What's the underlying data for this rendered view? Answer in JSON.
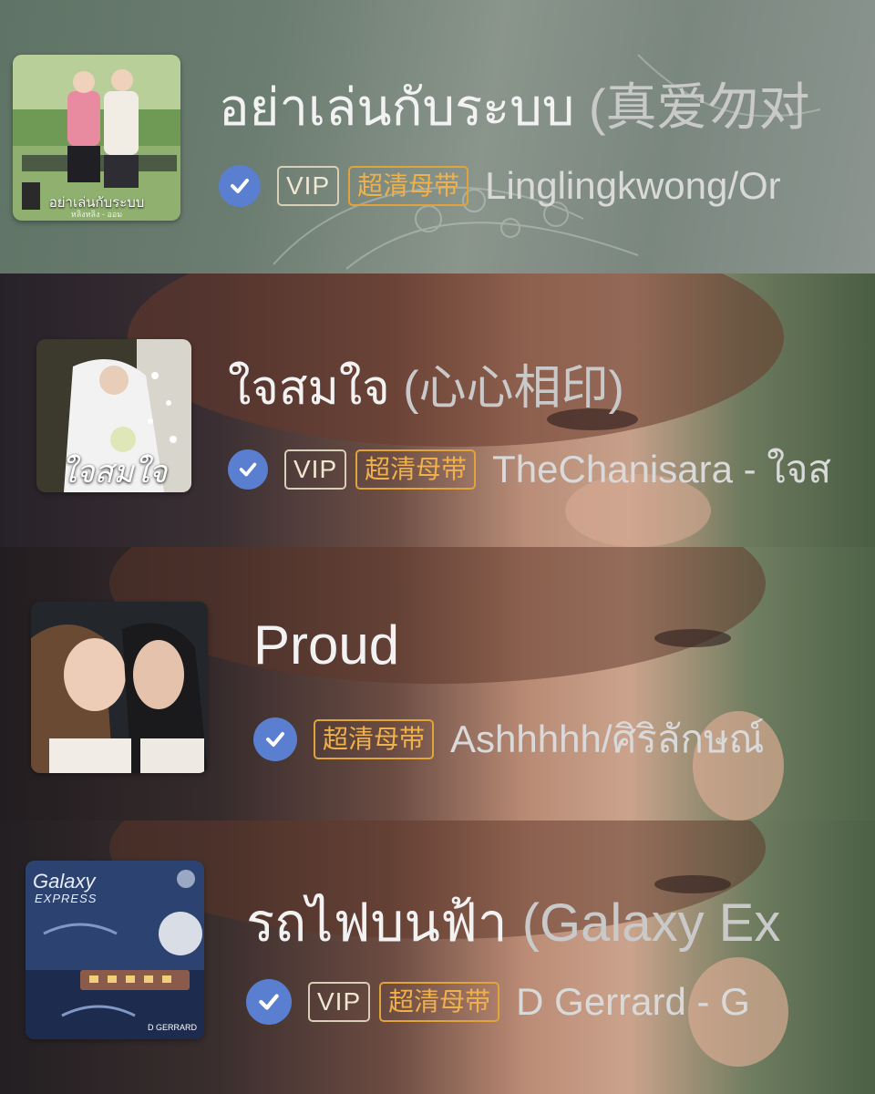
{
  "songs": [
    {
      "title": "อย่าเล่นกับระบบ",
      "subtitle": "(真爱勿对",
      "verified": true,
      "badges": [
        "VIP",
        "超清母带"
      ],
      "artist": "Linglingkwong/Or",
      "cover_text": "อย่าเล่นกับระบบ",
      "cover_subtext": "หลิงหลิง - ออม"
    },
    {
      "title": "ใจสมใจ",
      "subtitle": "(心心相印)",
      "verified": true,
      "badges": [
        "VIP",
        "超清母带"
      ],
      "artist": "TheChanisara - ใจส",
      "cover_text": "ใจสมใจ"
    },
    {
      "title": "Proud",
      "subtitle": "",
      "verified": true,
      "badges": [
        "超清母带"
      ],
      "artist": "Ashhhhh/ศิริลักษณ์"
    },
    {
      "title": "รถไฟบนฟ้า",
      "subtitle": "(Galaxy Ex",
      "verified": true,
      "badges": [
        "VIP",
        "超清母带"
      ],
      "artist": "D Gerrard - G",
      "cover_text": "Galaxy",
      "cover_text2": "EXPRESS",
      "cover_subtext": "D GERRARD"
    }
  ],
  "colors": {
    "verified": "#5b7fd0",
    "vip_border": "#d8cfb8",
    "hq_badge": "#f0b04a",
    "title": "#f2f2f2",
    "subtitle": "#c9c9c9"
  },
  "icons": {
    "verified": "check-icon"
  }
}
